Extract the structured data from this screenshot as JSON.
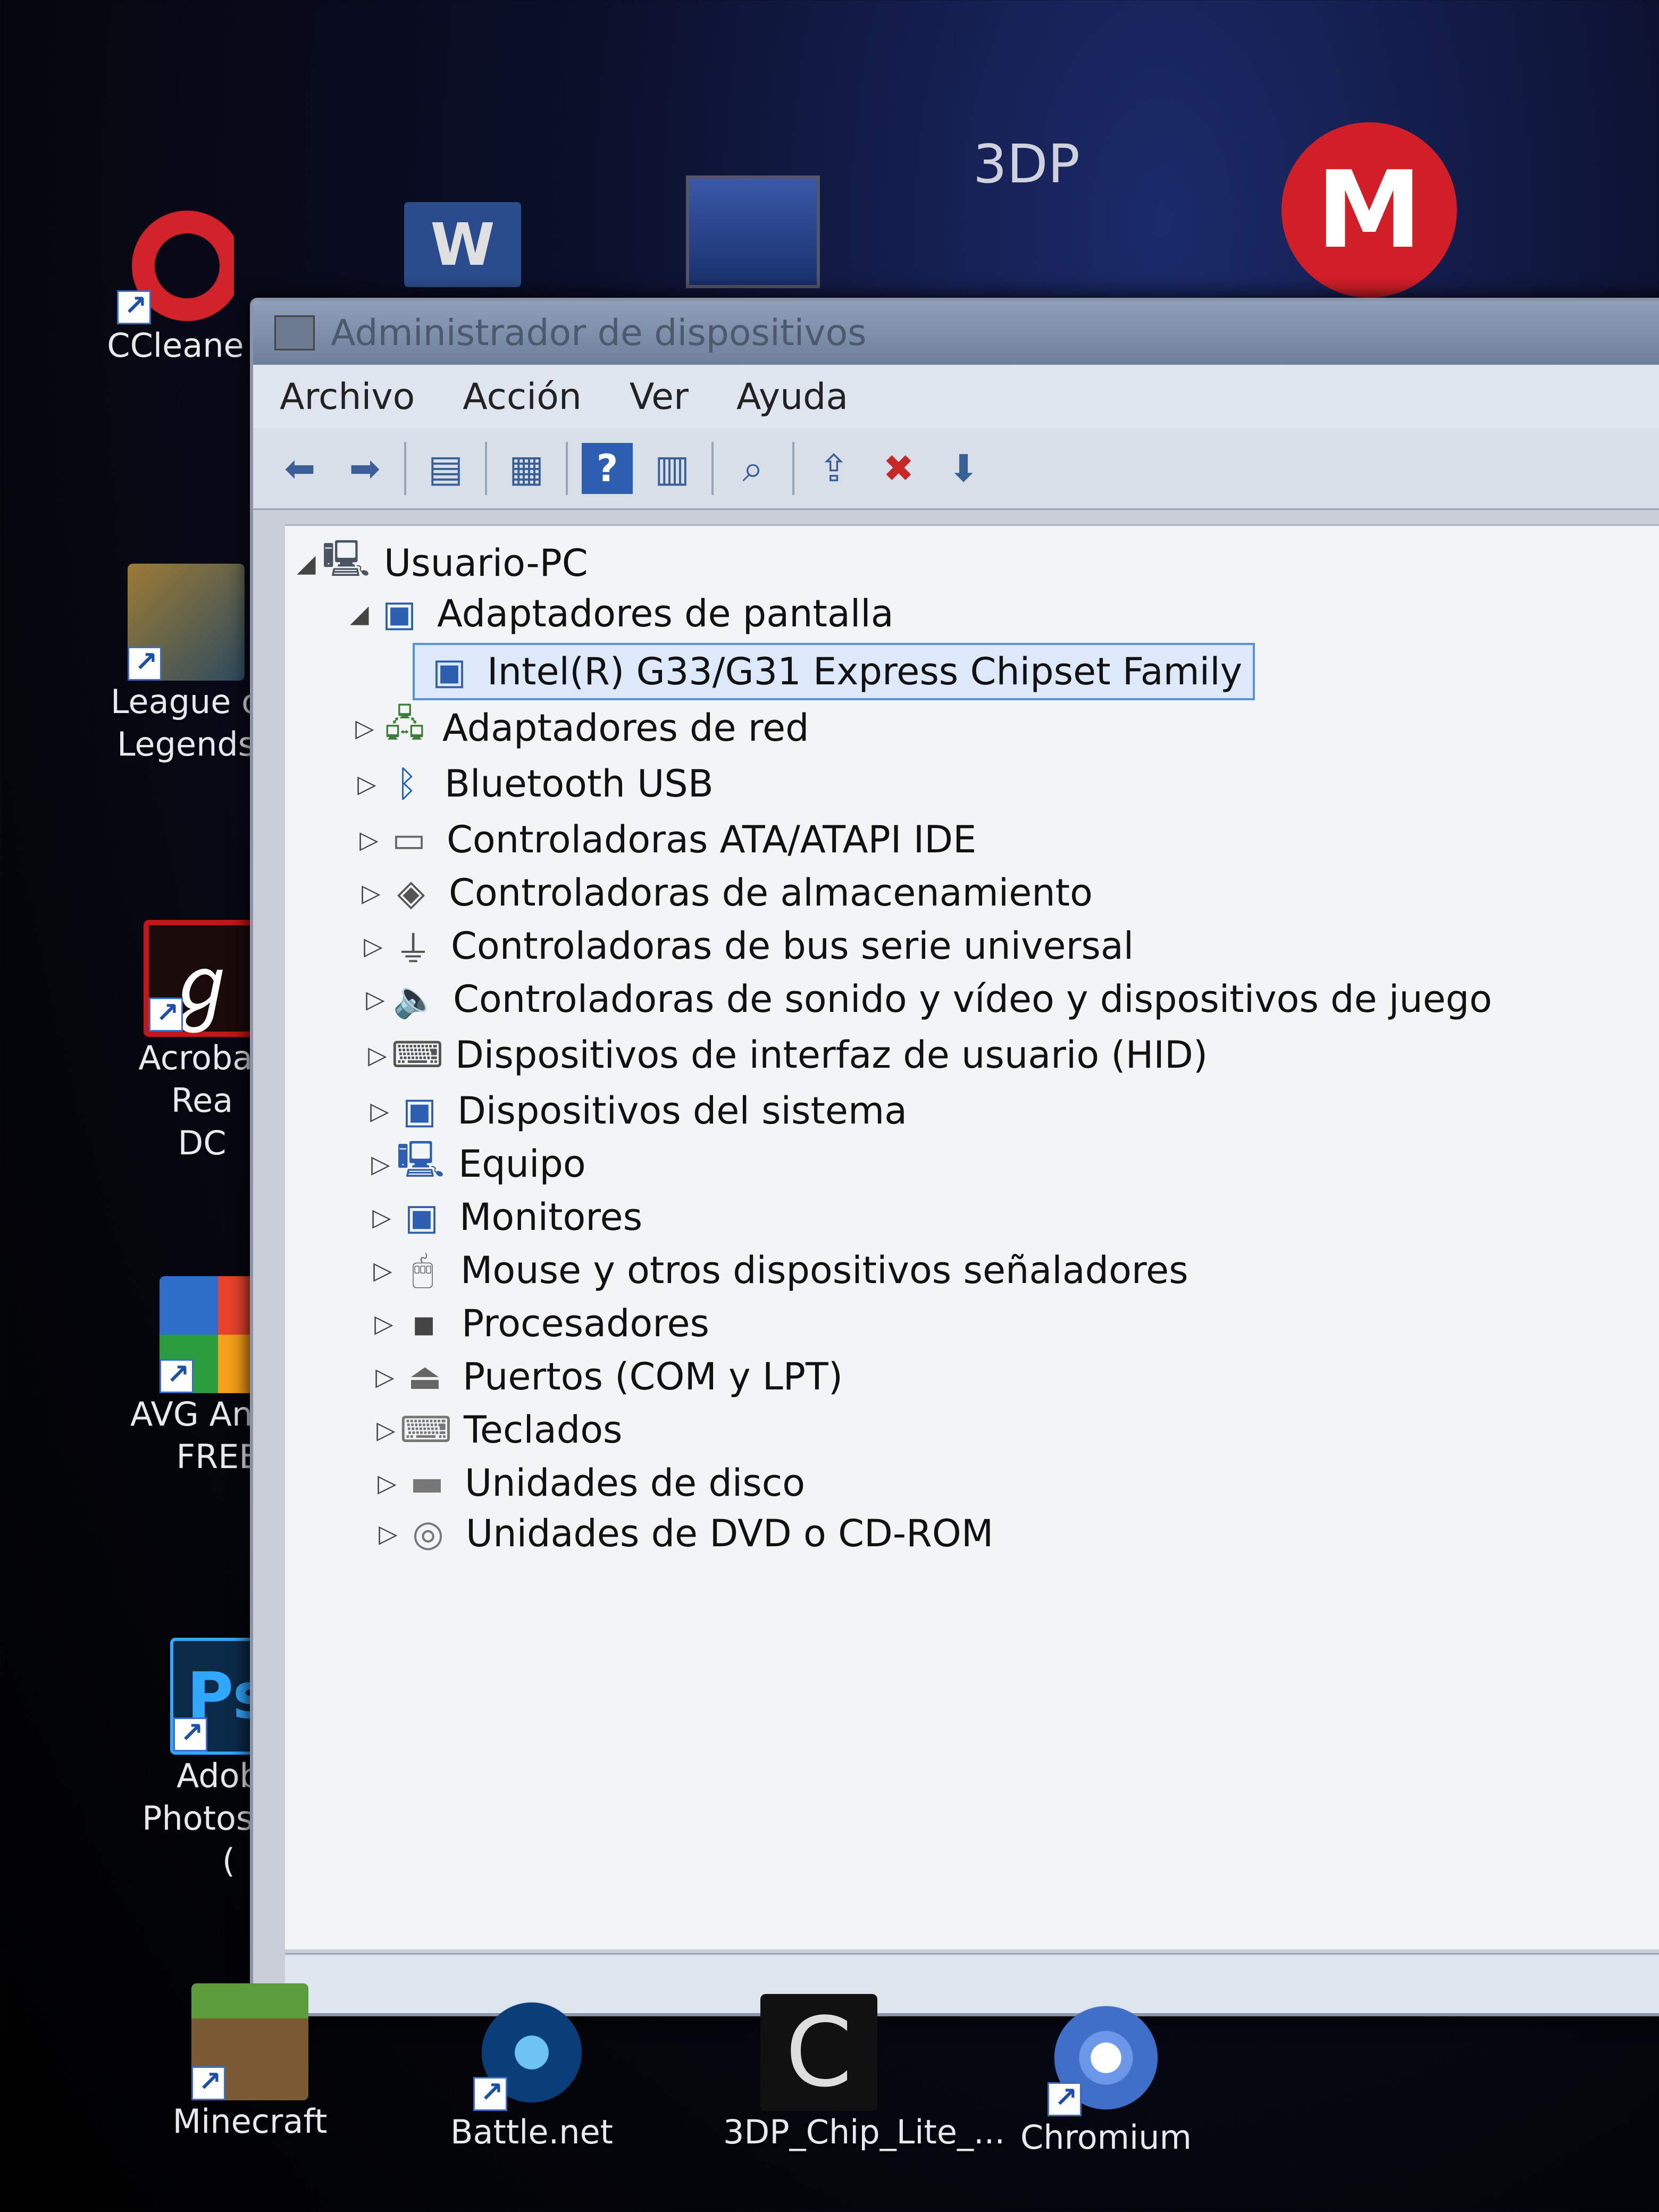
{
  "desktop_icons": [
    {
      "label": "CCleane"
    },
    {
      "label": "League o\nLegends"
    },
    {
      "label": "Acrobat Rea\nDC"
    },
    {
      "label": "AVG AntiVi\nFREE"
    },
    {
      "label": "Adobe\nPhotoshop ("
    },
    {
      "label": "Minecraft"
    },
    {
      "label": "Battle.net"
    },
    {
      "label": "3DP_Chip_Lite_..."
    },
    {
      "label": "Chromium"
    }
  ],
  "top_icons": {
    "word_letter": "W",
    "threedp_text": "3DP",
    "mega_letter": "M"
  },
  "window": {
    "title": "Administrador de dispositivos",
    "menus": [
      "Archivo",
      "Acción",
      "Ver",
      "Ayuda"
    ]
  },
  "tree": {
    "root": "Usuario-PC",
    "items": [
      {
        "label": "Adaptadores de pantalla",
        "icon": "display-adapter-icon",
        "expanded": true
      },
      {
        "label": "Intel(R) G33/G31 Express Chipset Family",
        "icon": "display-adapter-icon",
        "selected": true
      },
      {
        "label": "Adaptadores de red",
        "icon": "network-icon"
      },
      {
        "label": "Bluetooth USB",
        "icon": "bluetooth-icon"
      },
      {
        "label": "Controladoras ATA/ATAPI IDE",
        "icon": "ide-controller-icon"
      },
      {
        "label": "Controladoras de almacenamiento",
        "icon": "storage-icon"
      },
      {
        "label": "Controladoras de bus serie universal",
        "icon": "usb-icon"
      },
      {
        "label": "Controladoras de sonido y vídeo y dispositivos de juego",
        "icon": "speaker-icon"
      },
      {
        "label": "Dispositivos de interfaz de usuario (HID)",
        "icon": "hid-icon"
      },
      {
        "label": "Dispositivos del sistema",
        "icon": "system-device-icon"
      },
      {
        "label": "Equipo",
        "icon": "computer-icon"
      },
      {
        "label": "Monitores",
        "icon": "monitor-icon"
      },
      {
        "label": "Mouse y otros dispositivos señaladores",
        "icon": "mouse-icon"
      },
      {
        "label": "Procesadores",
        "icon": "processor-icon"
      },
      {
        "label": "Puertos (COM y LPT)",
        "icon": "port-icon"
      },
      {
        "label": "Teclados",
        "icon": "keyboard-icon"
      },
      {
        "label": "Unidades de disco",
        "icon": "disk-drive-icon"
      },
      {
        "label": "Unidades de DVD o CD-ROM",
        "icon": "dvd-drive-icon"
      }
    ]
  }
}
